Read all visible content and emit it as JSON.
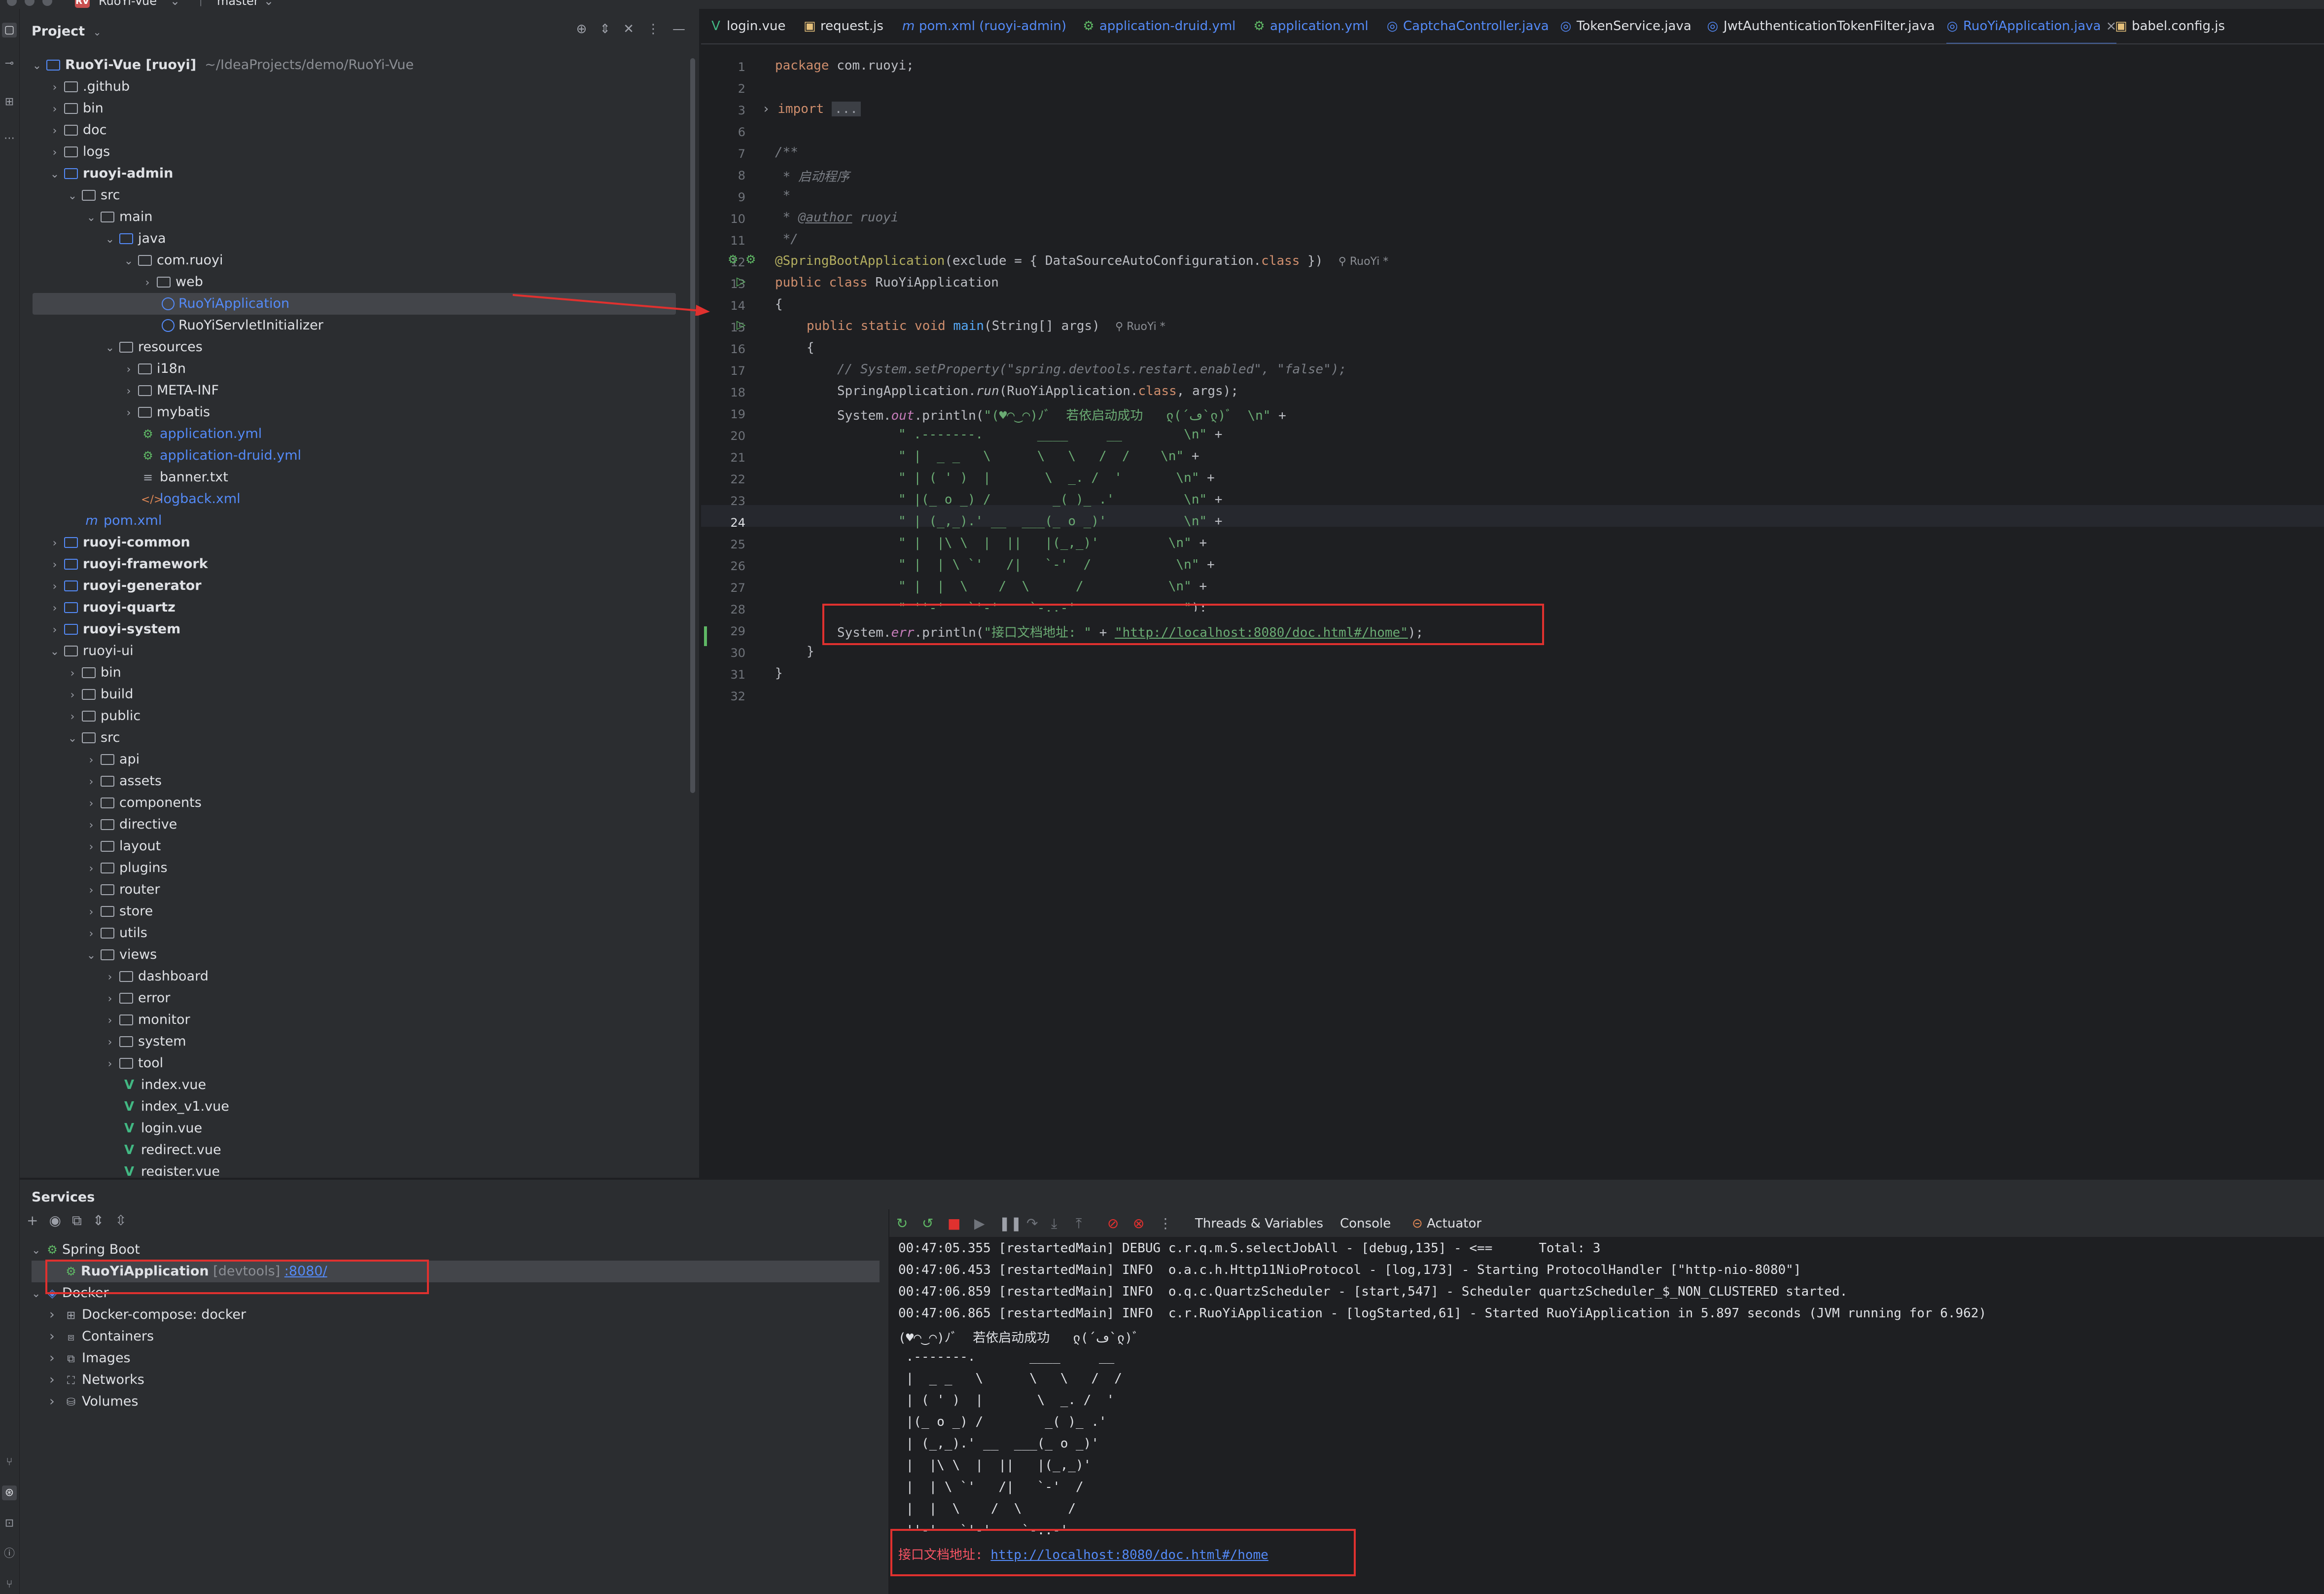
{
  "titlebar": {
    "project_badge": "RV",
    "project_name": "RuoYi-Vue",
    "branch": "master"
  },
  "project_panel": {
    "title": "Project",
    "root_name": "RuoYi-Vue [ruoyi]",
    "root_path": "~/IdeaProjects/demo/RuoYi-Vue",
    "items": [
      {
        "label": ".github"
      },
      {
        "label": "bin"
      },
      {
        "label": "doc"
      },
      {
        "label": "logs"
      },
      {
        "label": "ruoyi-admin"
      },
      {
        "label": "src"
      },
      {
        "label": "main"
      },
      {
        "label": "java"
      },
      {
        "label": "com.ruoyi"
      },
      {
        "label": "web"
      },
      {
        "label": "RuoYiApplication"
      },
      {
        "label": "RuoYiServletInitializer"
      },
      {
        "label": "resources"
      },
      {
        "label": "i18n"
      },
      {
        "label": "META-INF"
      },
      {
        "label": "mybatis"
      },
      {
        "label": "application.yml"
      },
      {
        "label": "application-druid.yml"
      },
      {
        "label": "banner.txt"
      },
      {
        "label": "logback.xml"
      },
      {
        "label": "pom.xml"
      },
      {
        "label": "ruoyi-common"
      },
      {
        "label": "ruoyi-framework"
      },
      {
        "label": "ruoyi-generator"
      },
      {
        "label": "ruoyi-quartz"
      },
      {
        "label": "ruoyi-system"
      },
      {
        "label": "ruoyi-ui"
      },
      {
        "label": "bin"
      },
      {
        "label": "build"
      },
      {
        "label": "public"
      },
      {
        "label": "src"
      },
      {
        "label": "api"
      },
      {
        "label": "assets"
      },
      {
        "label": "components"
      },
      {
        "label": "directive"
      },
      {
        "label": "layout"
      },
      {
        "label": "plugins"
      },
      {
        "label": "router"
      },
      {
        "label": "store"
      },
      {
        "label": "utils"
      },
      {
        "label": "views"
      },
      {
        "label": "dashboard"
      },
      {
        "label": "error"
      },
      {
        "label": "monitor"
      },
      {
        "label": "system"
      },
      {
        "label": "tool"
      },
      {
        "label": "index.vue"
      },
      {
        "label": "index_v1.vue"
      },
      {
        "label": "login.vue"
      },
      {
        "label": "redirect.vue"
      },
      {
        "label": "register.vue"
      }
    ]
  },
  "editor": {
    "tabs": [
      {
        "label": "login.vue"
      },
      {
        "label": "request.js"
      },
      {
        "label": "pom.xml (ruoyi-admin)"
      },
      {
        "label": "application-druid.yml"
      },
      {
        "label": "application.yml"
      },
      {
        "label": "CaptchaController.java"
      },
      {
        "label": "TokenService.java"
      },
      {
        "label": "JwtAuthenticationTokenFilter.java"
      },
      {
        "label": "RuoYiApplication.java"
      },
      {
        "label": "babel.config.js"
      }
    ],
    "line_numbers": [
      "1",
      "2",
      "3",
      "6",
      "7",
      "8",
      "9",
      "10",
      "11",
      "12",
      "13",
      "14",
      "15",
      "16",
      "17",
      "18",
      "19",
      "20",
      "21",
      "22",
      "23",
      "24",
      "25",
      "26",
      "27",
      "28",
      "29",
      "30",
      "31",
      "32"
    ],
    "code": {
      "l1_kw": "package",
      "l1_rest": " com.ruoyi;",
      "l3_kw": "import",
      "l3_fold": "...",
      "l7": "/**",
      "l8": " * 启动程序",
      "l9": " *",
      "l10_a": " * ",
      "l10_tag": "@author",
      "l10_b": " ruoyi",
      "l11": " */",
      "l12_an": "@SpringBootApplication",
      "l12_a": "(exclude = { DataSourceAutoConfiguration.",
      "l12_kw": "class",
      "l12_b": " })",
      "l12_hint": "RuoYi *",
      "l13_kw": "public class",
      "l13_rest": " RuoYiApplication",
      "l14": "{",
      "l15_kw": "public static void",
      "l15_fn": " main",
      "l15_rest": "(String[] args)",
      "l15_hint": "RuoYi *",
      "l16": "{",
      "l17": "// System.setProperty(\"spring.devtools.restart.enabled\", \"false\");",
      "l18_a": "SpringApplication.",
      "l18_fn": "run",
      "l18_b": "(RuoYiApplication.",
      "l18_kw": "class",
      "l18_c": ", args);",
      "l19_a": "System.",
      "l19_fd": "out",
      "l19_b": ".println(",
      "l19_st": "\"(♥◠‿◠)ﾉﾞ  若依启动成功   ლ(´ڡ`ლ)ﾞ  \\n\"",
      "l19_c": " +",
      "l20_st": "\" .-------.       ____     __        \\n\"",
      "l21_st": "\" |  _ _   \\      \\   \\   /  /    \\n\"",
      "l22_st": "\" | ( ' )  |       \\  _. /  '       \\n\"",
      "l23_st": "\" |(_ o _) /        _( )_ .'         \\n\"",
      "l24_st": "\" | (_,_).' __  ___(_ o _)'          \\n\"",
      "l25_st": "\" |  |\\ \\  |  ||   |(_,_)'         \\n\"",
      "l26_st": "\" |  | \\ `'   /|   `-'  /           \\n\"",
      "l27_st": "\" |  |  \\    /  \\      /           \\n\"",
      "l28_st": "\" ''-'   `'-'    `-..-'              \"",
      "l28_c": ");",
      "plus": " +",
      "l29_a": "System.",
      "l29_fd": "err",
      "l29_b": ".println(",
      "l29_st1": "\"接口文档地址: \"",
      "l29_c": " + ",
      "l29_url": "\"http://localhost:8080/doc.html#/home\"",
      "l29_d": ");",
      "l30": "}",
      "l31": "}"
    }
  },
  "services": {
    "title": "Services",
    "tree": {
      "spring_boot": "Spring Boot",
      "app_name": "RuoYiApplication",
      "app_tag": "[devtools]",
      "app_port": ":8080/",
      "docker": "Docker",
      "docker_compose": "Docker-compose: docker",
      "containers": "Containers",
      "images": "Images",
      "networks": "Networks",
      "volumes": "Volumes"
    },
    "console_tabs": {
      "threads": "Threads & Variables",
      "console": "Console",
      "actuator": "Actuator"
    },
    "console_lines": [
      "00:47:05.355 [restartedMain] DEBUG c.r.q.m.S.selectJobAll - [debug,135] - <==      Total: 3",
      "00:47:06.453 [restartedMain] INFO  o.a.c.h.Http11NioProtocol - [log,173] - Starting ProtocolHandler [\"http-nio-8080\"]",
      "00:47:06.859 [restartedMain] INFO  o.q.c.QuartzScheduler - [start,547] - Scheduler quartzScheduler_$_NON_CLUSTERED started.",
      "00:47:06.865 [restartedMain] INFO  c.r.RuoYiApplication - [logStarted,61] - Started RuoYiApplication in 5.897 seconds (JVM running for 6.962)",
      "(♥◠‿◠)ﾉﾞ  若依启动成功   ლ(´ڡ`ლ)ﾞ",
      " .-------.       ____     __",
      " |  _ _   \\      \\   \\   /  /",
      " | ( ' )  |       \\  _. /  '",
      " |(_ o _) /        _( )_ .'",
      " | (_,_).' __  ___(_ o _)'",
      " |  |\\ \\  |  ||   |(_,_)'",
      " |  | \\ `'   /|   `-'  /",
      " |  |  \\    /  \\      /",
      " ''-'   `'-'    `-..-'"
    ],
    "console_err_label": "接口文档地址: ",
    "console_err_url": "http://localhost:8080/doc.html#/home"
  },
  "colors": {
    "accent": "#548af7",
    "highlight_box": "#e0312f",
    "string": "#6aab73",
    "keyword": "#cf8e6d"
  }
}
